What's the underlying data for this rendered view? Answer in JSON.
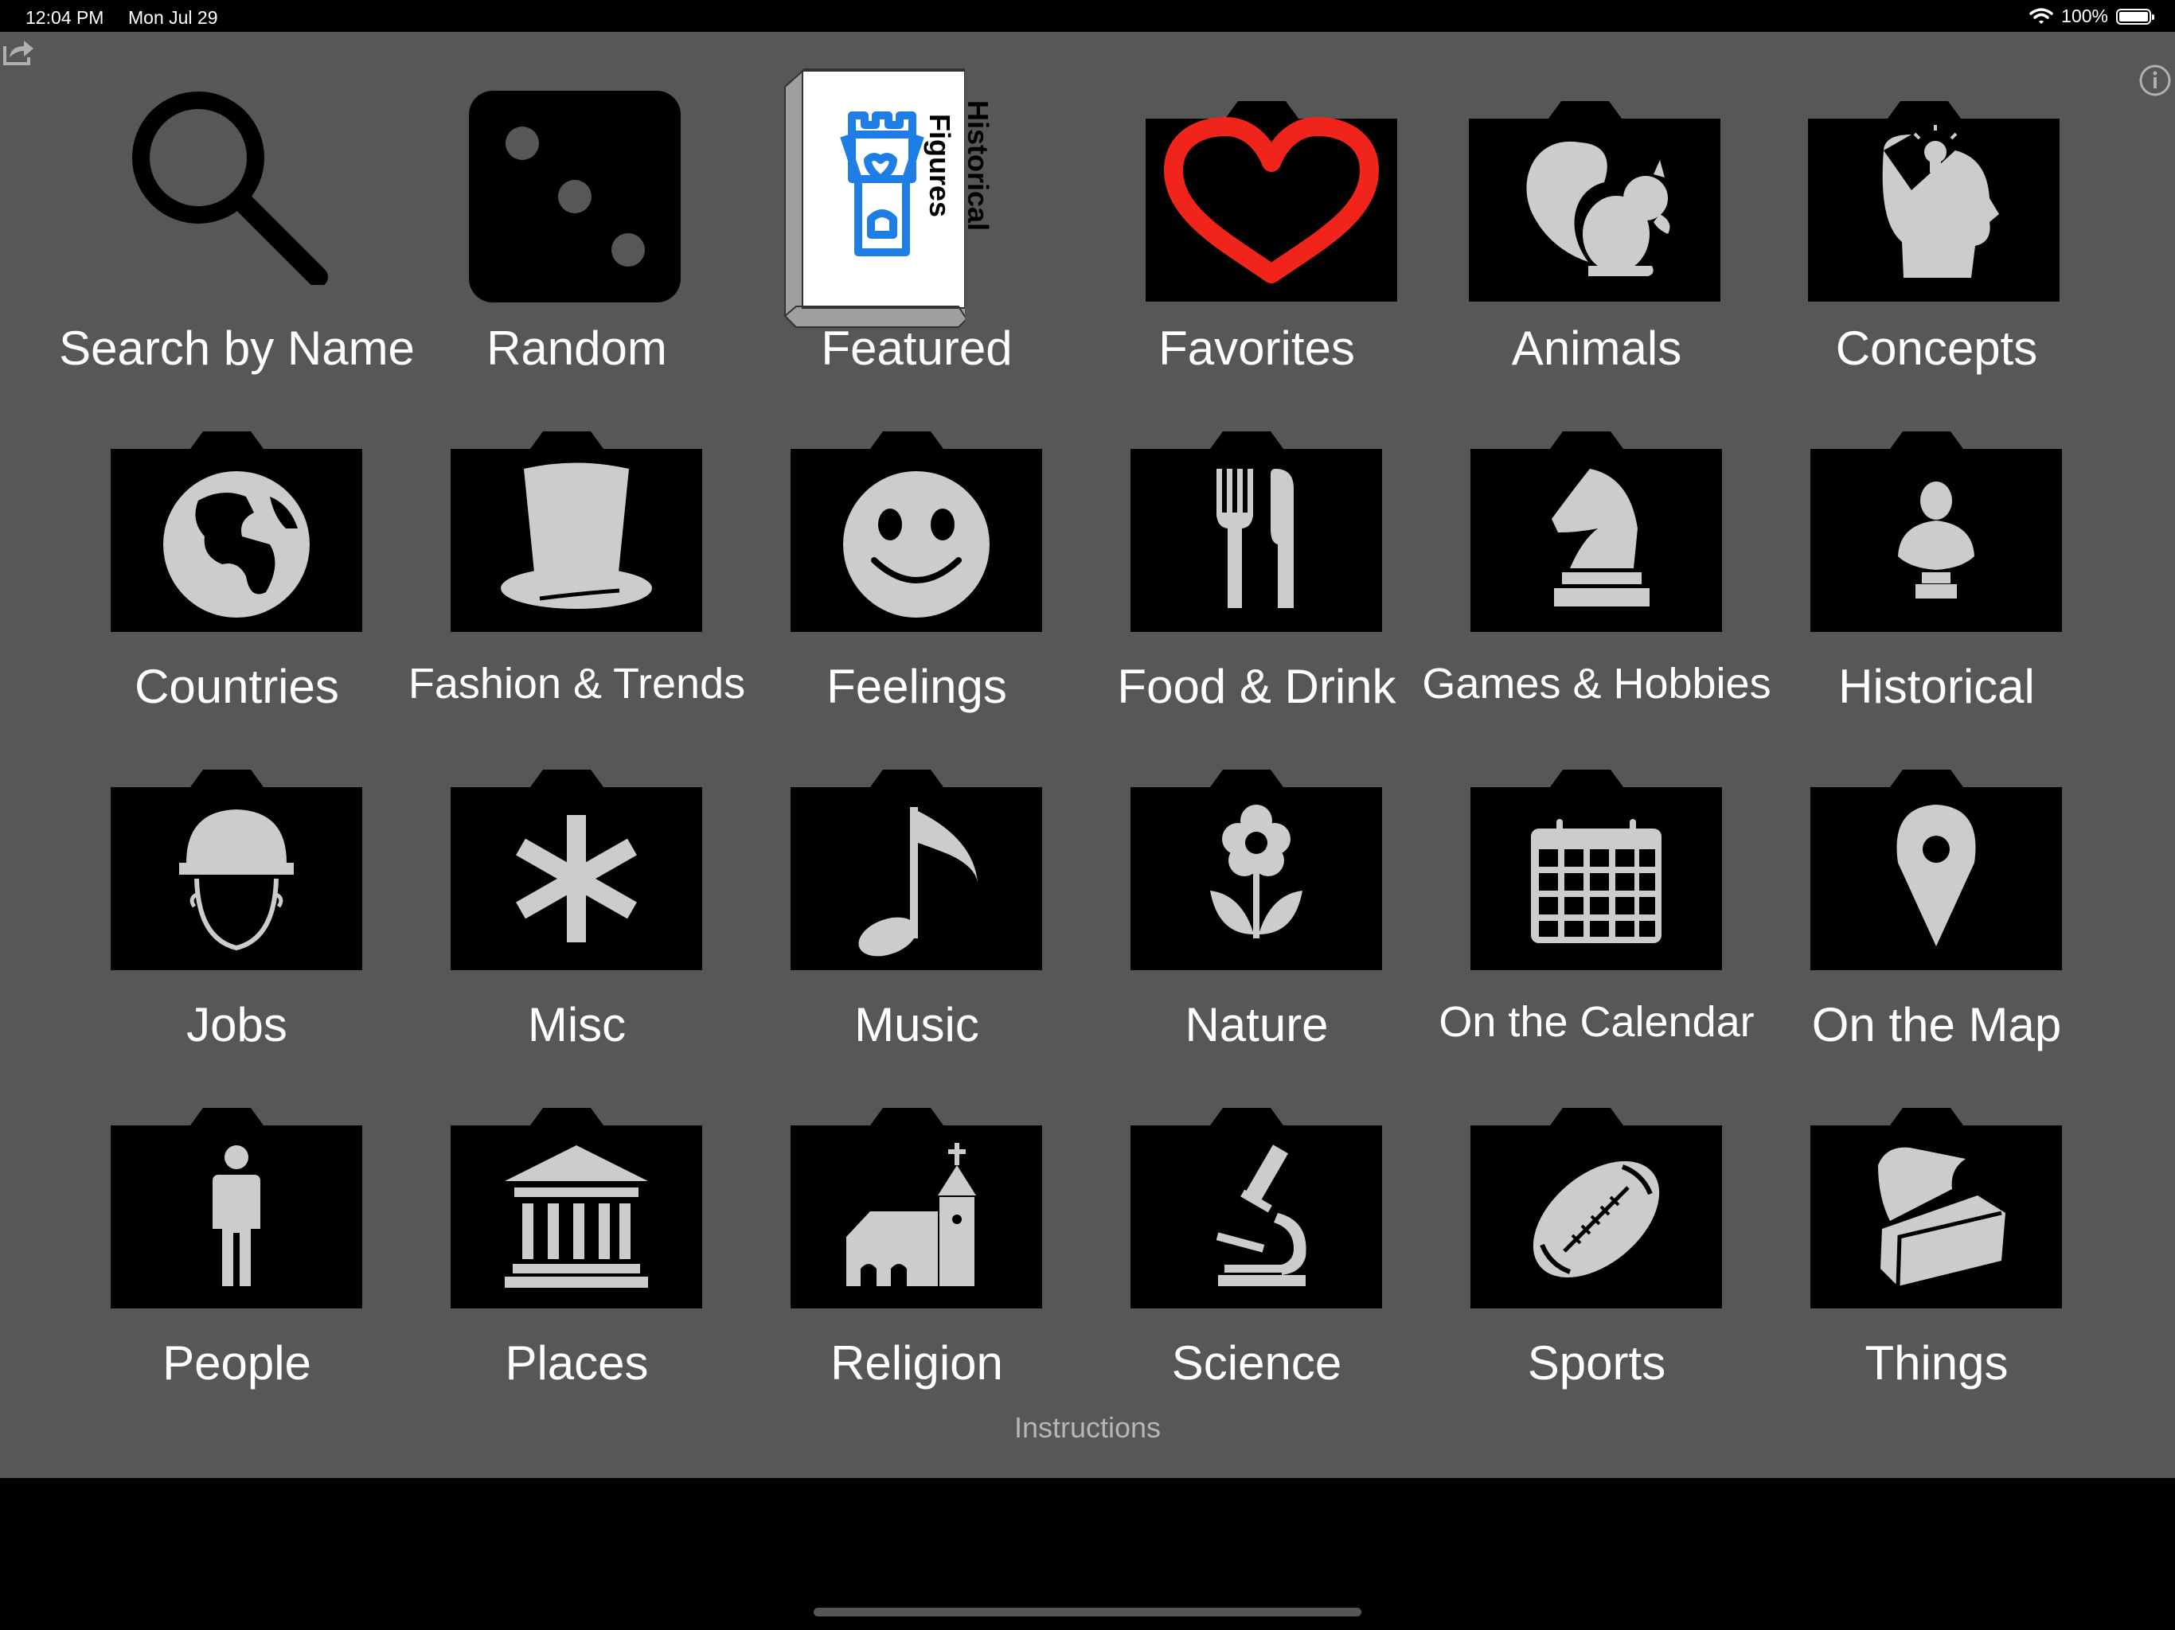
{
  "status_bar": {
    "time": "12:04 PM",
    "date": "Mon Jul 29",
    "battery": "100%"
  },
  "featured_card": {
    "title": "Historical Figures",
    "line1": "Historical",
    "line2": "Figures"
  },
  "categories": [
    {
      "label": "Search by Name",
      "icon": "magnifier-icon"
    },
    {
      "label": "Random",
      "icon": "dice-icon"
    },
    {
      "label": "Featured",
      "icon": "featured-card-icon"
    },
    {
      "label": "Favorites",
      "icon": "heart-icon"
    },
    {
      "label": "Animals",
      "icon": "squirrel-icon"
    },
    {
      "label": "Concepts",
      "icon": "head-lightbulb-icon"
    },
    {
      "label": "Countries",
      "icon": "globe-icon"
    },
    {
      "label": "Fashion & Trends",
      "icon": "top-hat-icon"
    },
    {
      "label": "Feelings",
      "icon": "smiley-icon"
    },
    {
      "label": "Food & Drink",
      "icon": "fork-knife-icon"
    },
    {
      "label": "Games & Hobbies",
      "icon": "chess-knight-icon"
    },
    {
      "label": "Historical",
      "icon": "bust-icon"
    },
    {
      "label": "Jobs",
      "icon": "hard-hat-worker-icon"
    },
    {
      "label": "Misc",
      "icon": "asterisk-icon"
    },
    {
      "label": "Music",
      "icon": "music-note-icon"
    },
    {
      "label": "Nature",
      "icon": "flower-icon"
    },
    {
      "label": "On the Calendar",
      "icon": "calendar-icon"
    },
    {
      "label": "On the Map",
      "icon": "map-pin-icon"
    },
    {
      "label": "People",
      "icon": "person-icon"
    },
    {
      "label": "Places",
      "icon": "building-columns-icon"
    },
    {
      "label": "Religion",
      "icon": "church-icon"
    },
    {
      "label": "Science",
      "icon": "microscope-icon"
    },
    {
      "label": "Sports",
      "icon": "football-icon"
    },
    {
      "label": "Things",
      "icon": "chest-icon"
    }
  ],
  "footer": {
    "instructions": "Instructions"
  },
  "colors": {
    "panel": "#575757",
    "folder": "#000000",
    "glyph": "#cccccc",
    "heart": "#f0241b",
    "castle": "#1f7ee6"
  }
}
